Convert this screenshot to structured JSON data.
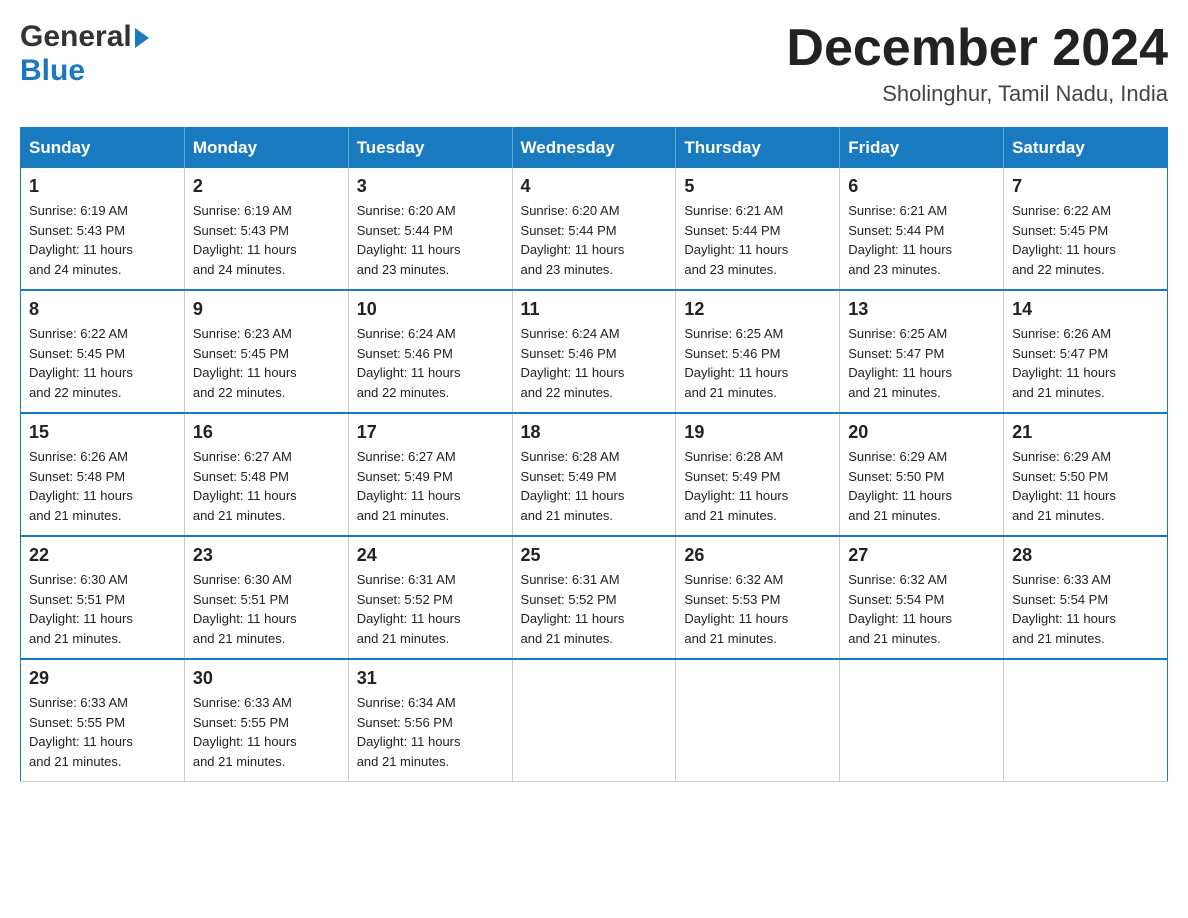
{
  "header": {
    "logo_general": "General",
    "logo_blue": "Blue",
    "month_year": "December 2024",
    "location": "Sholinghur, Tamil Nadu, India"
  },
  "days_of_week": [
    "Sunday",
    "Monday",
    "Tuesday",
    "Wednesday",
    "Thursday",
    "Friday",
    "Saturday"
  ],
  "weeks": [
    [
      {
        "num": "1",
        "sunrise": "6:19 AM",
        "sunset": "5:43 PM",
        "daylight": "11 hours and 24 minutes."
      },
      {
        "num": "2",
        "sunrise": "6:19 AM",
        "sunset": "5:43 PM",
        "daylight": "11 hours and 24 minutes."
      },
      {
        "num": "3",
        "sunrise": "6:20 AM",
        "sunset": "5:44 PM",
        "daylight": "11 hours and 23 minutes."
      },
      {
        "num": "4",
        "sunrise": "6:20 AM",
        "sunset": "5:44 PM",
        "daylight": "11 hours and 23 minutes."
      },
      {
        "num": "5",
        "sunrise": "6:21 AM",
        "sunset": "5:44 PM",
        "daylight": "11 hours and 23 minutes."
      },
      {
        "num": "6",
        "sunrise": "6:21 AM",
        "sunset": "5:44 PM",
        "daylight": "11 hours and 23 minutes."
      },
      {
        "num": "7",
        "sunrise": "6:22 AM",
        "sunset": "5:45 PM",
        "daylight": "11 hours and 22 minutes."
      }
    ],
    [
      {
        "num": "8",
        "sunrise": "6:22 AM",
        "sunset": "5:45 PM",
        "daylight": "11 hours and 22 minutes."
      },
      {
        "num": "9",
        "sunrise": "6:23 AM",
        "sunset": "5:45 PM",
        "daylight": "11 hours and 22 minutes."
      },
      {
        "num": "10",
        "sunrise": "6:24 AM",
        "sunset": "5:46 PM",
        "daylight": "11 hours and 22 minutes."
      },
      {
        "num": "11",
        "sunrise": "6:24 AM",
        "sunset": "5:46 PM",
        "daylight": "11 hours and 22 minutes."
      },
      {
        "num": "12",
        "sunrise": "6:25 AM",
        "sunset": "5:46 PM",
        "daylight": "11 hours and 21 minutes."
      },
      {
        "num": "13",
        "sunrise": "6:25 AM",
        "sunset": "5:47 PM",
        "daylight": "11 hours and 21 minutes."
      },
      {
        "num": "14",
        "sunrise": "6:26 AM",
        "sunset": "5:47 PM",
        "daylight": "11 hours and 21 minutes."
      }
    ],
    [
      {
        "num": "15",
        "sunrise": "6:26 AM",
        "sunset": "5:48 PM",
        "daylight": "11 hours and 21 minutes."
      },
      {
        "num": "16",
        "sunrise": "6:27 AM",
        "sunset": "5:48 PM",
        "daylight": "11 hours and 21 minutes."
      },
      {
        "num": "17",
        "sunrise": "6:27 AM",
        "sunset": "5:49 PM",
        "daylight": "11 hours and 21 minutes."
      },
      {
        "num": "18",
        "sunrise": "6:28 AM",
        "sunset": "5:49 PM",
        "daylight": "11 hours and 21 minutes."
      },
      {
        "num": "19",
        "sunrise": "6:28 AM",
        "sunset": "5:49 PM",
        "daylight": "11 hours and 21 minutes."
      },
      {
        "num": "20",
        "sunrise": "6:29 AM",
        "sunset": "5:50 PM",
        "daylight": "11 hours and 21 minutes."
      },
      {
        "num": "21",
        "sunrise": "6:29 AM",
        "sunset": "5:50 PM",
        "daylight": "11 hours and 21 minutes."
      }
    ],
    [
      {
        "num": "22",
        "sunrise": "6:30 AM",
        "sunset": "5:51 PM",
        "daylight": "11 hours and 21 minutes."
      },
      {
        "num": "23",
        "sunrise": "6:30 AM",
        "sunset": "5:51 PM",
        "daylight": "11 hours and 21 minutes."
      },
      {
        "num": "24",
        "sunrise": "6:31 AM",
        "sunset": "5:52 PM",
        "daylight": "11 hours and 21 minutes."
      },
      {
        "num": "25",
        "sunrise": "6:31 AM",
        "sunset": "5:52 PM",
        "daylight": "11 hours and 21 minutes."
      },
      {
        "num": "26",
        "sunrise": "6:32 AM",
        "sunset": "5:53 PM",
        "daylight": "11 hours and 21 minutes."
      },
      {
        "num": "27",
        "sunrise": "6:32 AM",
        "sunset": "5:54 PM",
        "daylight": "11 hours and 21 minutes."
      },
      {
        "num": "28",
        "sunrise": "6:33 AM",
        "sunset": "5:54 PM",
        "daylight": "11 hours and 21 minutes."
      }
    ],
    [
      {
        "num": "29",
        "sunrise": "6:33 AM",
        "sunset": "5:55 PM",
        "daylight": "11 hours and 21 minutes."
      },
      {
        "num": "30",
        "sunrise": "6:33 AM",
        "sunset": "5:55 PM",
        "daylight": "11 hours and 21 minutes."
      },
      {
        "num": "31",
        "sunrise": "6:34 AM",
        "sunset": "5:56 PM",
        "daylight": "11 hours and 21 minutes."
      },
      null,
      null,
      null,
      null
    ]
  ],
  "labels": {
    "sunrise": "Sunrise:",
    "sunset": "Sunset:",
    "daylight": "Daylight:"
  }
}
